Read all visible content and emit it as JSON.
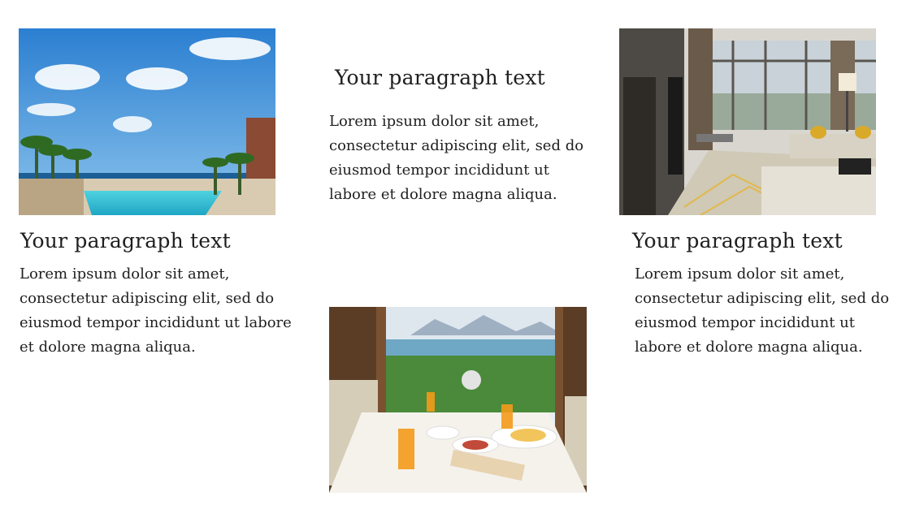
{
  "cards": [
    {
      "heading": "Your paragraph text",
      "body": "Lorem ipsum dolor sit amet, consectetur adipiscing elit, sed do eiusmod tempor incididunt ut labore et dolore magna aliqua.",
      "image": "resort-pool-photo"
    },
    {
      "heading": "Your paragraph text",
      "body": "Lorem ipsum dolor sit amet, consectetur adipiscing elit, sed do eiusmod tempor incididunt ut labore et dolore magna aliqua.",
      "image": "restaurant-breakfast-photo"
    },
    {
      "heading": "Your paragraph text",
      "body": "Lorem ipsum dolor sit amet, consectetur adipiscing elit, sed do eiusmod tempor incididunt ut labore et dolore magna aliqua.",
      "image": "hotel-room-photo"
    }
  ]
}
